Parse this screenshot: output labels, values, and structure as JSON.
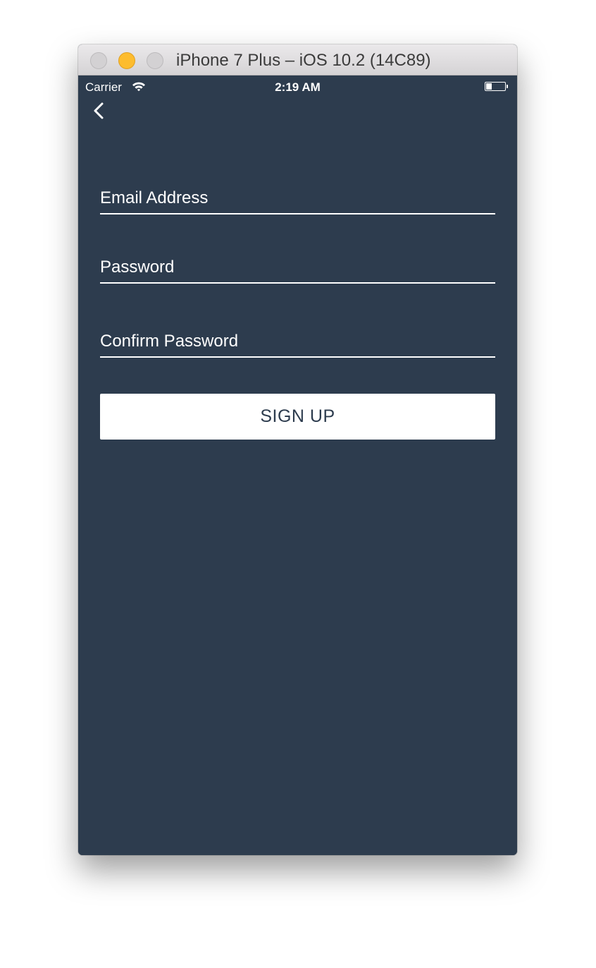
{
  "window": {
    "title": "iPhone 7 Plus – iOS 10.2 (14C89)"
  },
  "status_bar": {
    "carrier": "Carrier",
    "time": "2:19 AM",
    "battery_level": 0.3
  },
  "nav": {
    "back_icon": "chevron-left-icon"
  },
  "form": {
    "email_placeholder": "Email Address",
    "password_placeholder": "Password",
    "confirm_password_placeholder": "Confirm Password",
    "email_value": "",
    "password_value": "",
    "confirm_password_value": "",
    "signup_label": "SIGN UP"
  },
  "colors": {
    "background": "#2d3c4e",
    "button_background": "#ffffff",
    "button_text": "#2d3c4e",
    "field_text": "#ffffff",
    "minimize_button": "#fdbc2e"
  }
}
